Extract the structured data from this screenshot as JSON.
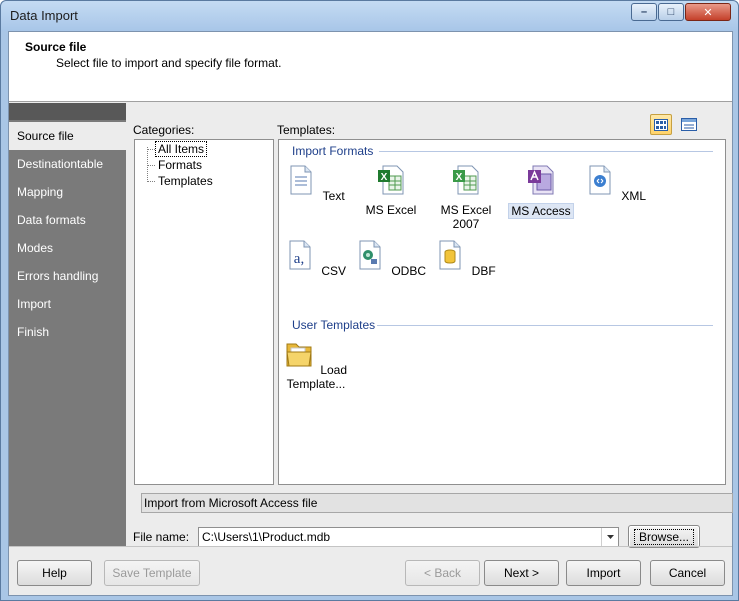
{
  "window": {
    "title": "Data Import",
    "minimize_glyph": "–",
    "maximize_glyph": "□",
    "close_glyph": "✕"
  },
  "header": {
    "title": "Source file",
    "subtitle": "Select file to import and specify file format."
  },
  "sidebar": {
    "items": [
      {
        "label": "Source file",
        "active": true
      },
      {
        "label": "Destinationtable",
        "active": false
      },
      {
        "label": "Mapping",
        "active": false
      },
      {
        "label": "Data formats",
        "active": false
      },
      {
        "label": "Modes",
        "active": false
      },
      {
        "label": "Errors handling",
        "active": false
      },
      {
        "label": "Import",
        "active": false
      },
      {
        "label": "Finish",
        "active": false
      }
    ]
  },
  "categories": {
    "label": "Categories:",
    "items": [
      "All Items",
      "Formats",
      "Templates"
    ],
    "selected": "All Items"
  },
  "templates": {
    "label": "Templates:",
    "import_formats_heading": "Import Formats",
    "formats": [
      {
        "label": "Text",
        "icon": "text-file-icon"
      },
      {
        "label": "MS Excel",
        "icon": "excel-file-icon"
      },
      {
        "label": "MS Excel 2007",
        "icon": "excel-2007-file-icon"
      },
      {
        "label": "MS Access",
        "icon": "access-file-icon",
        "selected": true
      },
      {
        "label": "XML",
        "icon": "xml-file-icon"
      },
      {
        "label": "CSV",
        "icon": "csv-file-icon"
      },
      {
        "label": "ODBC",
        "icon": "odbc-file-icon"
      },
      {
        "label": "DBF",
        "icon": "dbf-file-icon"
      }
    ],
    "user_templates_heading": "User Templates",
    "user_templates": [
      {
        "label_line1": "Load",
        "label_line2": "Template...",
        "icon": "folder-icon"
      }
    ]
  },
  "status_text": "Import from Microsoft Access file",
  "file": {
    "label": "File name:",
    "value": "C:\\Users\\1\\Product.mdb",
    "browse_label": "Browse..."
  },
  "footer": {
    "help": "Help",
    "save_template": "Save Template",
    "back": "< Back",
    "next": "Next >",
    "import": "Import",
    "cancel": "Cancel"
  },
  "colors": {
    "title_bar": "#b6d0ee",
    "sidebar_bg": "#7a7a7a",
    "group_heading": "#1e3f8a",
    "close_button": "#c4402a"
  }
}
